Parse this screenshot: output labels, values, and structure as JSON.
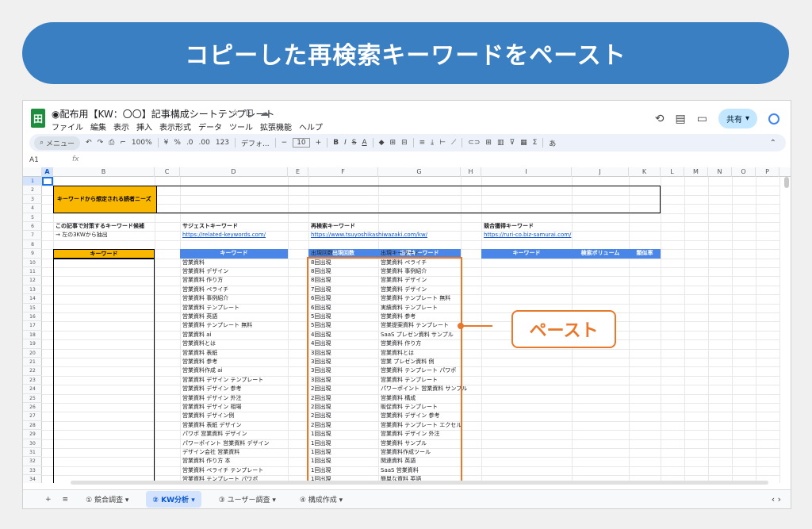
{
  "banner": "コピーした再検索キーワードをペースト",
  "app": {
    "logo": "田",
    "title": "◉配布用【KW：〇〇】記事構成シートテンプレート",
    "title_icons": [
      "☆",
      "⊡",
      "☁"
    ],
    "menu": [
      "ファイル",
      "編集",
      "表示",
      "挿入",
      "表示形式",
      "データ",
      "ツール",
      "拡張機能",
      "ヘルプ"
    ],
    "share_label": "共有",
    "share_caret": "▾",
    "top_icons": [
      "⟲",
      "▤",
      "▭"
    ]
  },
  "toolbar": {
    "search": "メニュー",
    "undo": "↶",
    "redo": "↷",
    "print": "⎙",
    "paint": "⌐",
    "zoom": "100%",
    "currency": "¥",
    "percent": "%",
    "dec1": ".0",
    "dec2": ".00",
    "fmt": "123",
    "font": "デフォ...",
    "minus": "−",
    "size": "10",
    "plus": "+",
    "bold": "B",
    "italic": "I",
    "strike": "S",
    "color": "A",
    "fill": "◆",
    "borders": "⊞",
    "merge": "⊟",
    "align": "≡",
    "valign": "⤓",
    "wrap": "⊢",
    "rotate": "⟋",
    "link": "⊂⊃",
    "comment": "⊞",
    "chart": "▥",
    "filter": "⊽",
    "view": "▦",
    "sigma": "Σ",
    "ime": "あ",
    "collapse": "⌃"
  },
  "formula": {
    "ref": "A1",
    "fx": "fx"
  },
  "columns": [
    "A",
    "B",
    "C",
    "D",
    "E",
    "F",
    "G",
    "H",
    "I",
    "J",
    "K",
    "L",
    "M",
    "N",
    "O",
    "P"
  ],
  "rows": [
    "1",
    "2",
    "3",
    "4",
    "5",
    "6",
    "7",
    "8",
    "9",
    "10",
    "11",
    "12",
    "13",
    "14",
    "15",
    "16",
    "17",
    "18",
    "19",
    "20",
    "21",
    "22",
    "23",
    "24",
    "25",
    "26",
    "27",
    "28",
    "29",
    "30",
    "31",
    "32",
    "33",
    "34"
  ],
  "sheet": {
    "needs_label": "キーワードから想定される読者ニーズ",
    "target_title": "この記事で対策するキーワード候補",
    "target_note": "→ 左の3KWから抽出",
    "target_header": "キーワード",
    "suggest_title": "サジェストキーワード",
    "suggest_url": "https://related-keywords.com/",
    "suggest_header": "キーワード",
    "suggest_items": [
      "営業資料",
      "営業資料 デザイン",
      "営業資料 作り方",
      "営業資料 ペライチ",
      "営業資料 事例紹介",
      "営業資料 テンプレート",
      "営業資料 英語",
      "営業資料 テンプレート 無料",
      "営業資料 ai",
      "営業資料とは",
      "営業資料 表紙",
      "営業資料 参考",
      "営業資料作成 ai",
      "営業資料 デザイン テンプレート",
      "営業資料 デザイン 参考",
      "営業資料 デザイン 外注",
      "営業資料 デザイン 相場",
      "営業資料 デザイン例",
      "営業資料 表紙 デザイン",
      "パワポ 営業資料 デザイン",
      "パワーポイント 営業資料 デザイン",
      "デザイン会社 営業資料",
      "営業資料 作り方 本",
      "営業資料 ペライチ テンプレート",
      "営業資料 テンプレート パワポ"
    ],
    "research_title": "再検索キーワード",
    "research_url": "https://www.tsuyoshikashiwazaki.com/kw/",
    "research_headers": [
      "出現回数",
      "出現キーワード"
    ],
    "research_counts": [
      "出現回数",
      "8回出現",
      "8回出現",
      "8回出現",
      "7回出現",
      "6回出現",
      "6回出現",
      "5回出現",
      "5回出現",
      "4回出現",
      "4回出現",
      "3回出現",
      "3回出現",
      "3回出現",
      "3回出現",
      "2回出現",
      "2回出現",
      "2回出現",
      "2回出現",
      "2回出現",
      "1回出現",
      "1回出現",
      "1回出現",
      "1回出現",
      "1回出現",
      "1回出現"
    ],
    "research_keywords": [
      "出現キーワード",
      "営業資料 ペライチ",
      "営業資料 事例紹介",
      "営業資料 デザイン",
      "営業資料 デザイン",
      "営業資料 テンプレート 無料",
      "実績資料 テンプレート",
      "営業資料 参考",
      "営業提案資料 テンプレート",
      "SaaS プレゼン資料 サンプル",
      "営業資料 作り方",
      "営業資料とは",
      "営業 プレゼン資料 例",
      "営業資料 テンプレート パワポ",
      "営業資料 テンプレート",
      "パワーポイント 営業資料 サンプル",
      "営業資料 構成",
      "販促資料 テンプレート",
      "営業資料 デザイン 参考",
      "営業資料 テンプレート エクセル",
      "営業資料 デザイン 外注",
      "営業資料 サンプル",
      "営業資料作成ツール",
      "関連資料 英語",
      "SaaS 営業資料",
      "簡単な資料 英語"
    ],
    "competitor_title": "競合獲得キーワード",
    "competitor_url": "https://ruri-co.biz-samurai.com/",
    "competitor_headers": [
      "キーワード",
      "検索ボリューム",
      "類似率"
    ]
  },
  "paste_label": "ペースト",
  "tabs": {
    "add": "+",
    "list": "≡",
    "items": [
      "① 競合調査 ▾",
      "② KW分析 ▾",
      "③ ユーザー調査 ▾",
      "④ 構成作成 ▾"
    ],
    "right": "‹ ›"
  }
}
